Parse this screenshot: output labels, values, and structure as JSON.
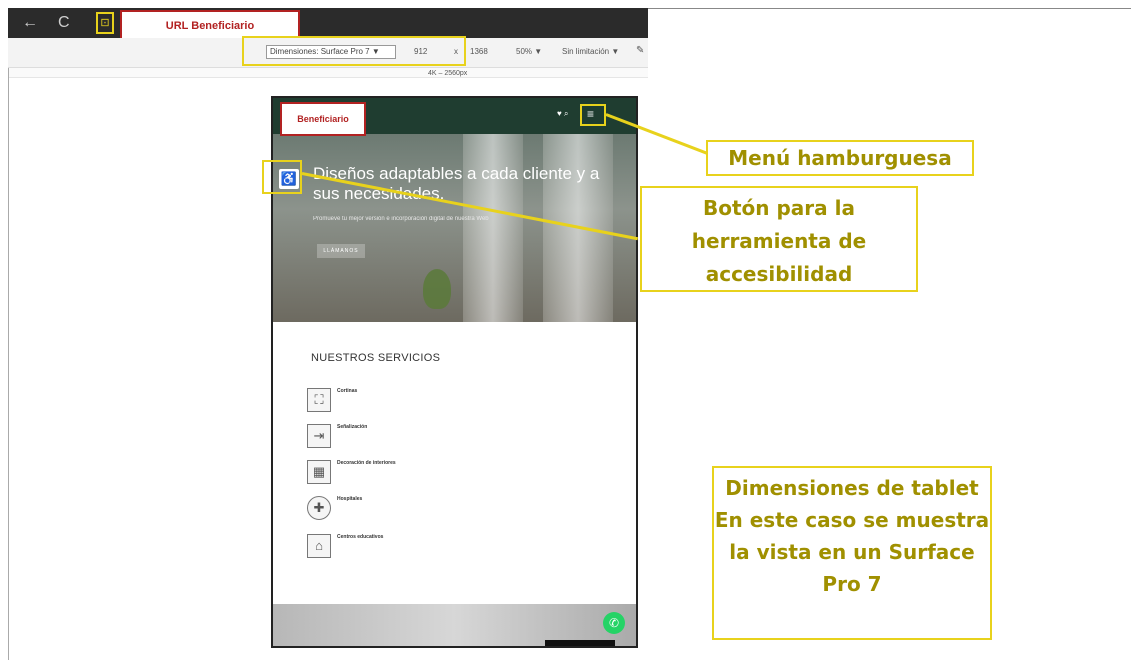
{
  "browser": {
    "nav_back": "←",
    "nav_reload": "C",
    "url_annotation": "URL Beneficiario",
    "device_select": "Dimensiones: Surface Pro 7 ▼",
    "width_value": "912",
    "times_symbol": "x",
    "height_value": "1368",
    "zoom": "50% ▼",
    "throttle": "Sin limitación ▼",
    "ruler_label": "4K – 2560px"
  },
  "site": {
    "hero_title": "Diseños adaptables a cada cliente y a sus necesidades.",
    "hero_subtitle": "Promueve tu mejor versión e incorporación digital de nuestra Web",
    "hero_button": "LLÁMANOS",
    "header_icons": "♥ ⌕",
    "services_title": "NUESTROS SERVICIOS",
    "services": [
      {
        "label": "Cortinas",
        "icon": "curtains-icon",
        "glyph": "⛶"
      },
      {
        "label": "Señalización",
        "icon": "signage-icon",
        "glyph": "⇥"
      },
      {
        "label": "Decoración de interiores",
        "icon": "interior-decor-icon",
        "glyph": "▦"
      },
      {
        "label": "Hospitales",
        "icon": "hospital-icon",
        "glyph": "✚"
      },
      {
        "label": "Centros educativos",
        "icon": "school-icon",
        "glyph": "⌂"
      }
    ],
    "whatsapp_glyph": "✆"
  },
  "annotations": {
    "beneficiario": "Beneficiario",
    "burger_label": "Menú hamburguesa",
    "accessibility_label": "Botón para la herramienta de accesibilidad",
    "tablet_label": "Dimensiones de tablet En este caso se muestra la vista en un Surface Pro 7"
  },
  "colors": {
    "highlight": "#e8d21c",
    "annotation_text": "#a09000",
    "badge_red": "#b22222",
    "site_header": "#1f3d30",
    "whatsapp": "#25d366"
  }
}
